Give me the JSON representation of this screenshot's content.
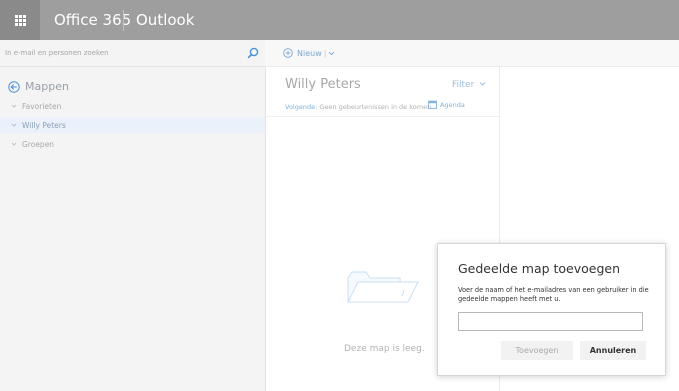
{
  "header": {
    "brand": "Office 365",
    "app_name": "Outlook"
  },
  "search": {
    "placeholder": "In e-mail en personen zoeken"
  },
  "command_bar": {
    "new_label": "Nieuw",
    "separator": "|"
  },
  "sidebar": {
    "folders_heading": "Mappen",
    "items": [
      {
        "label": "Favorieten",
        "selected": false
      },
      {
        "label": "Willy Peters",
        "selected": true
      },
      {
        "label": "Groepen",
        "selected": false
      }
    ]
  },
  "message_list": {
    "title": "Willy Peters",
    "filter_label": "Filter",
    "upcoming_label": "Volgende:",
    "upcoming_text": "Geen gebeurtenissen in de komen",
    "agenda_label": "Agenda",
    "empty_text": "Deze map is leeg."
  },
  "dialog": {
    "title": "Gedeelde map toevoegen",
    "description": "Voer de naam of het e-mailadres van een gebruiker in die gedeelde mappen heeft met u.",
    "input_value": "",
    "add_label": "Toevoegen",
    "cancel_label": "Annuleren"
  },
  "colors": {
    "topbar": "#9e9e9e",
    "accent": "#7fb1dc"
  }
}
